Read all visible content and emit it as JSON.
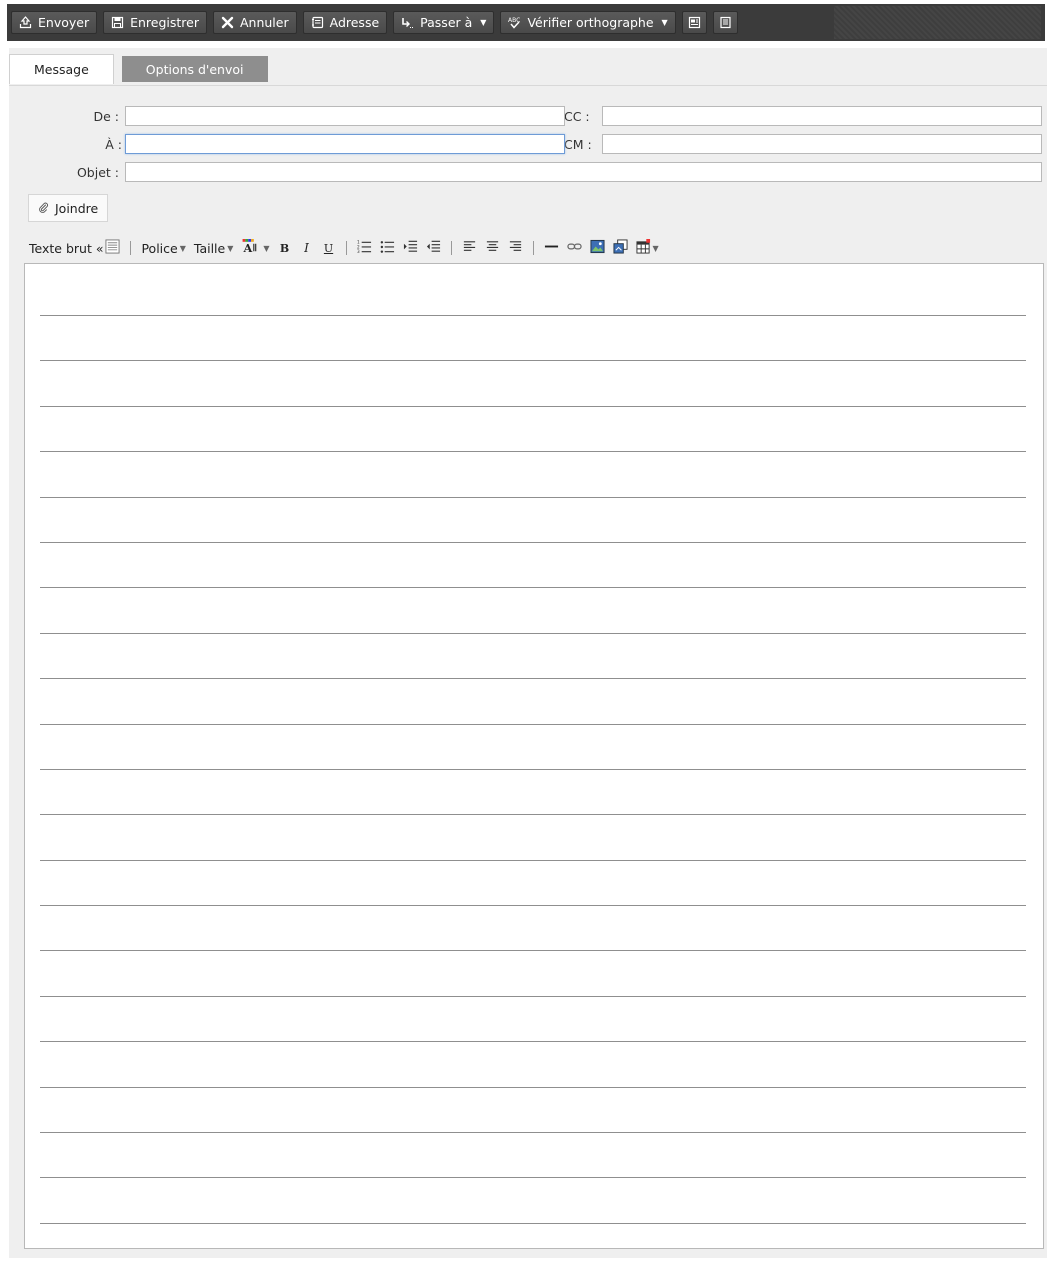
{
  "toolbar": {
    "send": "Envoyer",
    "save": "Enregistrer",
    "cancel": "Annuler",
    "address": "Adresse",
    "goto": "Passer à",
    "spellcheck": "Vérifier orthographe"
  },
  "tabs": {
    "message": "Message",
    "send_options": "Options d'envoi"
  },
  "fields": {
    "from_label": "De :",
    "to_label": "À :",
    "subject_label": "Objet :",
    "cc_label": "CC :",
    "bcc_label": "CM :",
    "from_value": "",
    "to_value": "",
    "subject_value": "",
    "cc_value": "",
    "bcc_value": ""
  },
  "attach": {
    "label": "Joindre"
  },
  "editor": {
    "plain_text": "Texte brut «",
    "font": "Police",
    "size": "Taille",
    "bold": "B",
    "italic": "I",
    "underline": "U"
  },
  "colors": {
    "toolbar_bg": "#3b3b3b",
    "panel_bg": "#efefef",
    "tab_inactive": "#8e8e8e",
    "focus_border": "#6e9bd6"
  },
  "icons": {
    "send": "send-icon",
    "save": "floppy-icon",
    "cancel": "close-icon",
    "address": "address-book-icon",
    "goto": "goto-icon",
    "spellcheck": "spellcheck-icon",
    "attach": "paperclip-icon"
  }
}
